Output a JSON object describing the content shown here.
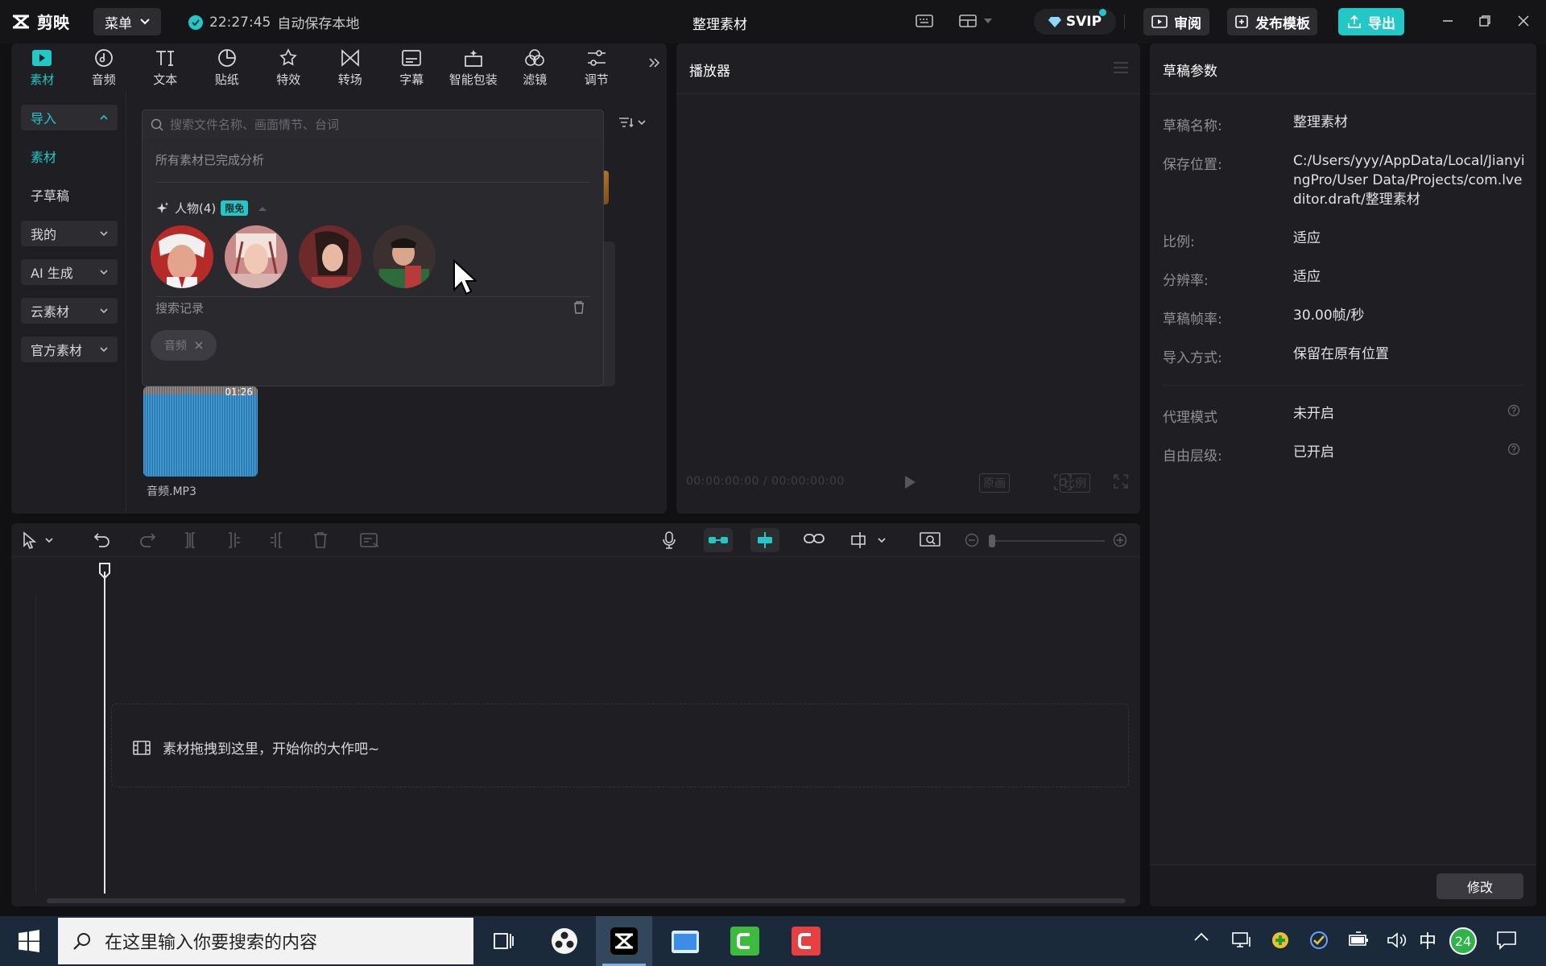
{
  "app": {
    "name": "剪映",
    "menu_label": "菜单",
    "autosave_time": "22:27:45",
    "autosave_text": "自动保存本地",
    "project_title": "整理素材",
    "svip_label": "SVIP",
    "review_label": "审阅",
    "publish_label": "发布模板",
    "export_label": "导出",
    "accent_color": "#22c7c6"
  },
  "media": {
    "categories": [
      {
        "label": "素材",
        "icon": "media-icon"
      },
      {
        "label": "音频",
        "icon": "audio-icon"
      },
      {
        "label": "文本",
        "icon": "text-icon"
      },
      {
        "label": "贴纸",
        "icon": "sticker-icon"
      },
      {
        "label": "特效",
        "icon": "effects-icon"
      },
      {
        "label": "转场",
        "icon": "transition-icon"
      },
      {
        "label": "字幕",
        "icon": "subtitle-icon"
      },
      {
        "label": "智能包装",
        "icon": "smart-pack-icon"
      },
      {
        "label": "滤镜",
        "icon": "filter-icon"
      },
      {
        "label": "调节",
        "icon": "adjust-icon"
      }
    ],
    "side_nav": [
      {
        "label": "导入"
      },
      {
        "label": "素材"
      },
      {
        "label": "子草稿"
      },
      {
        "label": "我的"
      },
      {
        "label": "AI 生成"
      },
      {
        "label": "云素材"
      },
      {
        "label": "官方素材"
      }
    ],
    "search": {
      "placeholder": "搜索文件名称、画面情节、台词",
      "value": ""
    },
    "dropdown": {
      "analysis_text": "所有素材已完成分析",
      "people_label": "人物(4)",
      "free_tag": "限免",
      "history_label": "搜索记录",
      "history_items": [
        "音频"
      ]
    },
    "audio_item": {
      "name": "音频.MP3",
      "duration": "01:26"
    }
  },
  "player": {
    "title": "播放器",
    "current_time": "00:00:00:00",
    "total_time": "00:00:00:00",
    "original_label": "原画",
    "ratio_label": "比例"
  },
  "props": {
    "title": "草稿参数",
    "rows": [
      {
        "label": "草稿名称:",
        "value": "整理素材"
      },
      {
        "label": "保存位置:",
        "value": "C:/Users/yyy/AppData/Local/JianyingPro/User Data/Projects/com.lveditor.draft/整理素材"
      },
      {
        "label": "比例:",
        "value": "适应"
      },
      {
        "label": "分辨率:",
        "value": "适应"
      },
      {
        "label": "草稿帧率:",
        "value": "30.00帧/秒"
      },
      {
        "label": "导入方式:",
        "value": "保留在原有位置"
      },
      {
        "label": "代理模式",
        "value": "未开启"
      },
      {
        "label": "自由层级:",
        "value": "已开启"
      }
    ],
    "modify_label": "修改"
  },
  "timeline": {
    "drop_hint": "素材拖拽到这里，开始你的大作吧~"
  },
  "taskbar": {
    "search_placeholder": "在这里输入你要搜索的内容",
    "ime_label": "中",
    "notification_count": "24"
  }
}
